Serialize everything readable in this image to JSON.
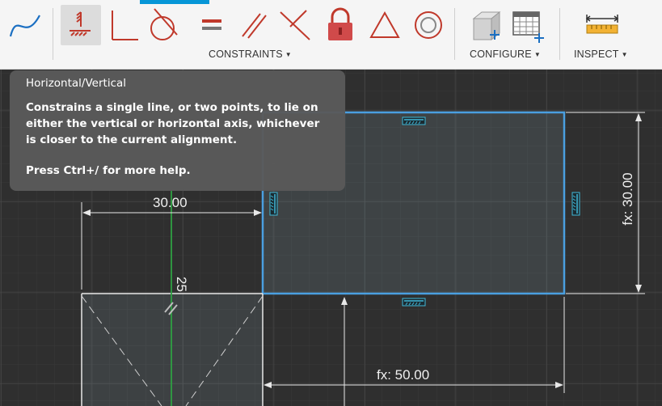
{
  "toolbar": {
    "groups": {
      "constraints": "CONSTRAINTS",
      "configure": "CONFIGURE",
      "inspect": "INSPECT"
    },
    "icons": [
      "spline-icon",
      "horizontal-vertical-icon",
      "perpendicular-icon",
      "tangent-icon",
      "equal-icon",
      "parallel-icon",
      "collinear-icon",
      "fix-lock-icon",
      "triangle-icon",
      "concentric-icon",
      "configure-box-icon",
      "configure-table-icon",
      "measure-icon"
    ],
    "accent": "#0696d7"
  },
  "tooltip": {
    "title": "Horizontal/Vertical",
    "body": "Constrains a single line, or two points, to lie on either the vertical or horizontal axis, whichever is closer to the current alignment.",
    "help": "Press Ctrl+/ for more help."
  },
  "canvas": {
    "dimensions": {
      "width_top": "30.00",
      "height_right": "fx: 30.00",
      "width_bottom": "fx: 50.00",
      "vertical_small": "25"
    },
    "colors": {
      "background": "#2f2f2f",
      "selected_edge": "#4a9fe0",
      "constraint_glyph": "#3fb8d8",
      "axis_green": "#2ea043"
    }
  }
}
